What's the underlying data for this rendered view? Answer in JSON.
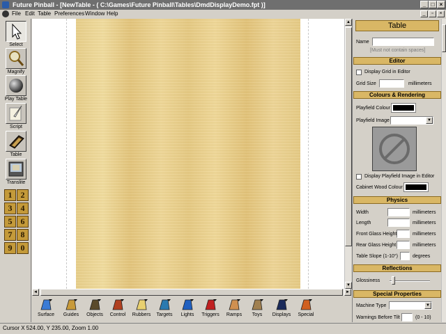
{
  "window": {
    "title": "Future Pinball - [NewTable - ( C:\\Games\\Future Pinball\\Tables\\DmdDisplayDemo.fpt )]"
  },
  "menu": {
    "items": [
      "File",
      "Edit",
      "Table",
      "Preferences",
      "Window",
      "Help"
    ]
  },
  "left_tools": [
    {
      "label": "Select",
      "icon": "arrow-cursor-icon"
    },
    {
      "label": "Magnify",
      "icon": "magnifier-icon"
    },
    {
      "label": "Play Table",
      "icon": "pinball-icon"
    },
    {
      "label": "Script",
      "icon": "quill-icon"
    },
    {
      "label": "Table",
      "icon": "table-icon"
    },
    {
      "label": "Translite",
      "icon": "translite-icon"
    }
  ],
  "number_buttons": [
    "1",
    "2",
    "3",
    "4",
    "5",
    "6",
    "7",
    "8",
    "9",
    "0"
  ],
  "bottom_tools": [
    {
      "label": "Surface",
      "icon": "surface-icon",
      "color": "#3a7bd5"
    },
    {
      "label": "Guides",
      "icon": "guides-icon",
      "color": "#c89a3a"
    },
    {
      "label": "Objects",
      "icon": "objects-icon",
      "color": "#5a4a2a"
    },
    {
      "label": "Control",
      "icon": "control-icon",
      "color": "#b04020"
    },
    {
      "label": "Rubbers",
      "icon": "rubbers-icon",
      "color": "#e8d070"
    },
    {
      "label": "Targets",
      "icon": "targets-icon",
      "color": "#2a7ab0"
    },
    {
      "label": "Lights",
      "icon": "lights-icon",
      "color": "#2060c0"
    },
    {
      "label": "Triggers",
      "icon": "triggers-icon",
      "color": "#c02020"
    },
    {
      "label": "Ramps",
      "icon": "ramps-icon",
      "color": "#d09050"
    },
    {
      "label": "Toys",
      "icon": "toys-icon",
      "color": "#a08050"
    },
    {
      "label": "Displays",
      "icon": "displays-icon",
      "color": "#1a2a5a"
    },
    {
      "label": "Special",
      "icon": "special-icon",
      "color": "#d06020"
    }
  ],
  "status": {
    "text": "Cursor X 524.00, Y 235.00, Zoom 1.00"
  },
  "panel": {
    "title": "Table",
    "name_label": "Name",
    "name_value": "",
    "name_hint": "[Must not contain spaces]",
    "editor_header": "Editor",
    "grid_check_label": "Display Grid in Editor",
    "grid_size_label": "Grid Size",
    "grid_size_unit": "millimeters",
    "colours_header": "Colours & Rendering",
    "playfield_colour_label": "Playfield Colour",
    "playfield_colour": "#000000",
    "playfield_image_label": "Playfield Image",
    "display_image_label": "Display Playfield Image in Editor",
    "cabinet_colour_label": "Cabinet Wood Colour",
    "cabinet_colour": "#000000",
    "physics_header": "Physics",
    "width_label": "Width",
    "length_label": "Length",
    "front_glass_label": "Front Glass Height",
    "rear_glass_label": "Rear Glass Height",
    "slope_label": "Table Slope (1-10°)",
    "unit_mm": "millimeters",
    "unit_deg": "degrees",
    "reflections_header": "Reflections",
    "glossiness_label": "Glossiness",
    "special_header": "Special Properties",
    "machine_type_label": "Machine Type",
    "warnings_label": "Warnings Before Tilt",
    "warnings_range": "(0 - 10)"
  }
}
